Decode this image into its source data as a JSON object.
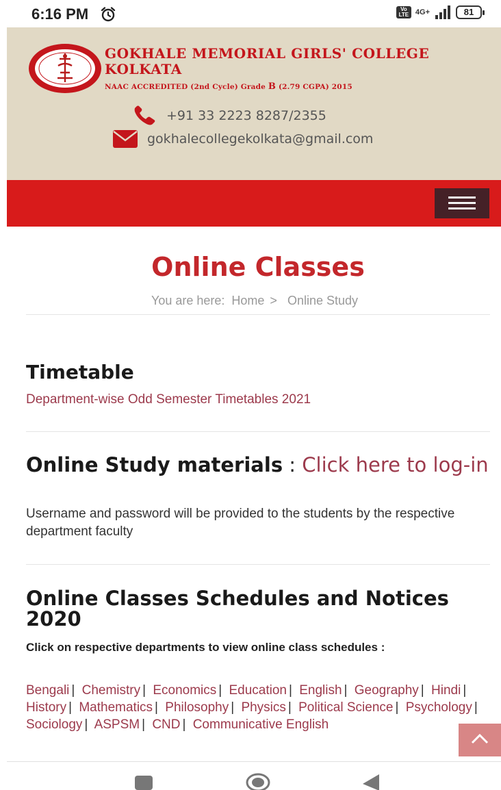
{
  "status_bar": {
    "time": "6:16 PM",
    "volte": "Vo LTE",
    "network": "4G+",
    "battery": "81"
  },
  "header": {
    "college_line1": "GOKHALE MEMORIAL GIRLS' COLLEGE",
    "college_line2": "KOLKATA",
    "naac_prefix": "NAAC ACCREDITED (2nd Cycle) Grade ",
    "naac_grade": "B",
    "naac_suffix": " (2.79 CGPA) 2015",
    "phone": "+91 33 2223 8287/2355",
    "email": "gokhalecollegekolkata@gmail.com"
  },
  "page": {
    "title": "Online Classes",
    "breadcrumb_prefix": "You are here:",
    "breadcrumb_home": "Home",
    "breadcrumb_sep": ">",
    "breadcrumb_current": "Online Study"
  },
  "timetable": {
    "heading": "Timetable",
    "link": "Department-wise Odd Semester Timetables 2021"
  },
  "study": {
    "heading": "Online Study materials",
    "colon": ":",
    "link": "Click here to log-in",
    "description": "Username and password will be provided to the students by the respective department faculty"
  },
  "schedules": {
    "heading": "Online Classes Schedules and Notices 2020",
    "subheading": "Click on respective departments to view online class schedules :",
    "departments": [
      "Bengali",
      "Chemistry",
      "Economics",
      "Education",
      "English",
      "Geography",
      "Hindi",
      "History",
      "Mathematics",
      "Philosophy",
      "Physics",
      "Political Science",
      "Psychology",
      "Sociology",
      "ASPSM",
      "CND",
      "Communicative English"
    ]
  },
  "colors": {
    "brand_red": "#d81b1b",
    "header_bg": "#e1d9c5",
    "link": "#9c3a4c",
    "menu_bg": "#452127"
  },
  "icons": [
    "alarm-icon",
    "signal-icon",
    "phone-icon",
    "mail-icon",
    "hamburger-menu-icon",
    "chevron-up-icon",
    "recents-icon",
    "home-icon",
    "back-icon"
  ]
}
